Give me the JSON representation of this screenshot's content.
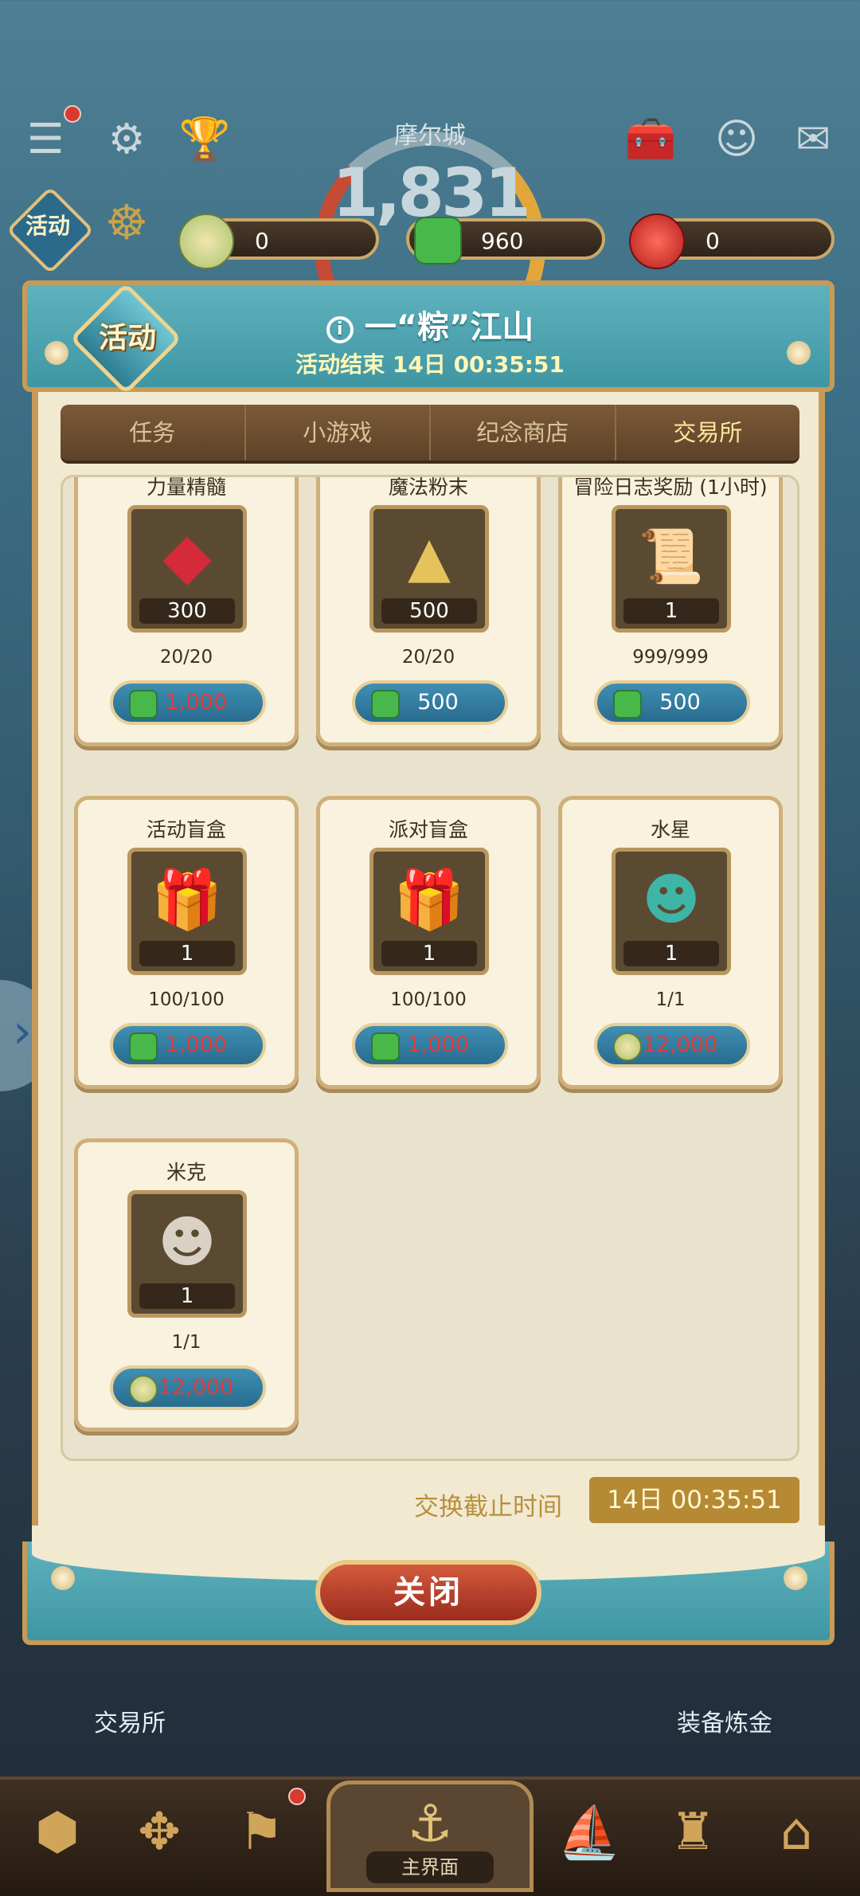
{
  "top": {
    "icons": [
      "menu-icon",
      "gear-icon",
      "trophy-icon",
      "toolbox-icon",
      "friends-icon",
      "mail-icon"
    ],
    "activity_label": "活动",
    "city_name": "摩尔城",
    "city_level": "1,831"
  },
  "resources": [
    {
      "icon": "zongzi-icon",
      "value": "0"
    },
    {
      "icon": "green-gem-icon",
      "value": "960"
    },
    {
      "icon": "red-pouch-icon",
      "value": "0"
    }
  ],
  "panel": {
    "badge": "活动",
    "title": "一“粽”江山",
    "subtitle": "活动结束 14日 00:35:51",
    "tabs": [
      "任务",
      "小游戏",
      "纪念商店",
      "交易所"
    ],
    "active_tab": "交易所",
    "items": [
      {
        "name": "力量精髓",
        "icon": "red-gem-icon",
        "qty": "300",
        "stock": "20/20",
        "price": "1,000",
        "currency": "green-gem-icon",
        "affordable": false
      },
      {
        "name": "魔法粉末",
        "icon": "gold-dust-icon",
        "qty": "500",
        "stock": "20/20",
        "price": "500",
        "currency": "green-gem-icon",
        "affordable": true
      },
      {
        "name": "冒险日志奖励 (1小时)",
        "icon": "scroll-icon",
        "qty": "1",
        "stock": "999/999",
        "price": "500",
        "currency": "green-gem-icon",
        "affordable": true
      },
      {
        "name": "活动盲盒",
        "icon": "gift-box-icon",
        "qty": "1",
        "stock": "100/100",
        "price": "1,000",
        "currency": "green-gem-icon",
        "affordable": false
      },
      {
        "name": "派对盲盒",
        "icon": "gift-box-icon",
        "qty": "1",
        "stock": "100/100",
        "price": "1,000",
        "currency": "green-gem-icon",
        "affordable": false
      },
      {
        "name": "水星",
        "icon": "character-icon",
        "qty": "1",
        "stock": "1/1",
        "price": "12,000",
        "currency": "zongzi-icon",
        "affordable": false
      },
      {
        "name": "米克",
        "icon": "character-icon",
        "qty": "1",
        "stock": "1/1",
        "price": "12,000",
        "currency": "zongzi-icon",
        "affordable": false
      }
    ],
    "deadline_label": "交换截止时间",
    "deadline_value": "14日  00:35:51",
    "close_label": "关闭"
  },
  "background_labels": {
    "left": "交易所",
    "right": "装备炼金"
  },
  "nav": {
    "home_label": "主界面"
  },
  "colors": {
    "accent_teal": "#4fa6b1",
    "frame_gold": "#c79b57",
    "price_red": "#e23b3b"
  }
}
